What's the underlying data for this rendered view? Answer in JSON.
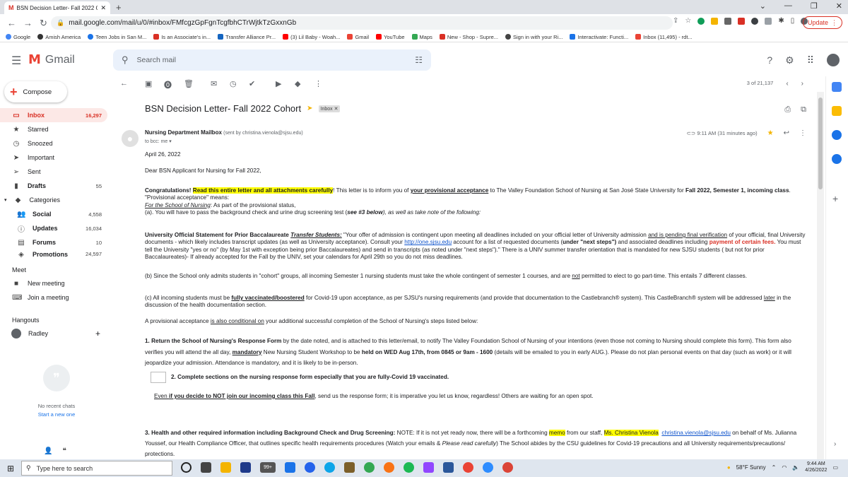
{
  "browser": {
    "tab_title": "BSN Decision Letter- Fall 2022 C",
    "url": "mail.google.com/mail/u/0/#inbox/FMfcgzGpFgnTcgfbhCTrWjtkTzGxxnGb",
    "update_label": "Update"
  },
  "bookmarks": [
    "Google",
    "Amish America",
    "Teen Jobs in San M...",
    "Is an Associate's in...",
    "Transfer Alliance Pr...",
    "(3) Lil Baby - Woah...",
    "Gmail",
    "YouTube",
    "Maps",
    "New - Shop - Supre...",
    "Sign in with your Ri...",
    "Interactivate: Functi...",
    "Inbox (11,495) - rdt..."
  ],
  "gmail": {
    "logo_text": "Gmail",
    "search_placeholder": "Search mail",
    "compose_label": "Compose",
    "nav": [
      {
        "label": "Inbox",
        "count": "16,297"
      },
      {
        "label": "Starred",
        "count": ""
      },
      {
        "label": "Snoozed",
        "count": ""
      },
      {
        "label": "Important",
        "count": ""
      },
      {
        "label": "Sent",
        "count": ""
      },
      {
        "label": "Drafts",
        "count": "55"
      },
      {
        "label": "Categories",
        "count": ""
      },
      {
        "label": "Social",
        "count": "4,558"
      },
      {
        "label": "Updates",
        "count": "16,034"
      },
      {
        "label": "Forums",
        "count": "10"
      },
      {
        "label": "Promotions",
        "count": "24,597"
      }
    ],
    "meet": {
      "heading": "Meet",
      "new_meeting": "New meeting",
      "join_meeting": "Join a meeting"
    },
    "hangouts": {
      "heading": "Hangouts",
      "user": "Radley",
      "no_chats": "No recent chats",
      "start_new": "Start a new one"
    },
    "paging": "3 of 21,137"
  },
  "email": {
    "subject": "BSN Decision Letter- Fall 2022 Cohort",
    "label": "Inbox",
    "sender_name": "Nursing Department Mailbox",
    "sender_via": "(sent by christina.vienola@sjsu.edu)",
    "to": "to bcc: me",
    "time": "9:11 AM (31 minutes ago)",
    "date": "April 26, 2022",
    "greeting": "Dear BSN Applicant for Nursing for Fall 2022,",
    "p1_a": "Congratulations! ",
    "p1_hl": "Read this entire letter and all attachments carefully",
    "p1_b": "! This letter is to inform you of ",
    "p1_u": "your provisional acceptance",
    "p1_c": " to The Valley Foundation School of Nursing at San José State University for ",
    "p1_d": "Fall 2022, Semester 1, incoming class",
    "p1_e": ". \"Provisional acceptance\" means:",
    "p1_f": "For the School of Nursing",
    "p1_g": ": As part of the provisional status,",
    "p1_h": "(a). You will have to pass the background check and urine drug screening test (",
    "p1_i": "see #3 below",
    "p1_j": "), as well as take note of the following:",
    "p2_a": "University Official Statement for Prior Baccalaureate ",
    "p2_b": "Transfer Students:",
    "p2_c": " \"Your offer of admission is contingent upon meeting all deadlines included on your official letter of University admission ",
    "p2_d": "and is pending final verification",
    "p2_e": " of your official, final University documents - which likely includes transcript updates (as well as University acceptance). Consult your ",
    "p2_link": "http://one.sjsu.edu",
    "p2_f": "  account for a list of requested documents (",
    "p2_g": "under \"next steps\")",
    "p2_h": " and associated deadlines including ",
    "p2_i": "payment of certain fees.",
    "p2_j": " You must tell the University \"yes or no\" (by May 1st with exception being prior Baccalaureates) and send in transcripts (as noted under \"next steps\").\" There is a UNIV summer transfer orientation that is mandated for new SJSU students ( but not for prior Baccalaureates)- If already accepted for the Fall by the UNIV, set your calendars for April 29th so you do not miss deadlines.",
    "p3_a": "(b) Since the School only admits students in \"cohort\" groups, all incoming Semester 1 nursing students must take the whole contingent of semester 1 courses, and are ",
    "p3_u": "not",
    "p3_b": " permitted to elect to go part-time. This entails 7 different classes.",
    "p4_a": "(c) All incoming students must be ",
    "p4_u": "fully vaccinated/boostered",
    "p4_b": " for Covid-19 upon acceptance, as per SJSU's nursing requirements (and provide that documentation to the Castlebranch® system). This CastleBranch® system will be addressed ",
    "p4_u2": "later",
    "p4_c": " in the discussion of the health documentation section.",
    "p5_a": "A provisional acceptance ",
    "p5_u": "is also conditional on",
    "p5_b": " your additional successful completion of the School of Nursing's steps listed below:",
    "p6_a": "1.  Return the School of Nursing's Response Form",
    "p6_b": " by the date noted, and is attached to this letter/email, to notify The Valley Foundation School of Nursing of your intentions (even those not coming to Nursing should complete this form). This form also verifies you will attend the all day, ",
    "p6_u": "mandatory",
    "p6_c": " New Nursing Student Workshop to be ",
    "p6_d": "held on WED Aug 17th, from 0845 or 9am - 1600",
    "p6_e": " (details will be emailed to you in early AUG.).  Please do not plan personal events on that day (such as work) or it will jeopardize your admission. Attendance is mandatory, and it is likely to be in-person.",
    "p7": "2.  Complete sections on the nursing response form especially that you are fully-Covid 19 vaccinated.",
    "p8_a": "Even ",
    "p8_b": "if you decide to NOT join our incoming class this Fall",
    "p8_c": ", send us the response form; it is imperative you let us know, regardless! Others are waiting for an open spot.",
    "p9_a": "3.  Health and other required information including Background Check and Drug Screening:",
    "p9_b": "  NOTE: If it is not yet ready now, there will be a forthcoming ",
    "p9_hl1": "memo",
    "p9_c": " from our staff, ",
    "p9_hl2": "Ms. Christina Vienola",
    "p9_link": "christina.vienola@sjsu.edu",
    "p9_d": "  on behalf of Ms. Julianna Youssef, our Health Compliance Officer, that outlines specific health requirements procedures (Watch your emails & ",
    "p9_i": "Please read carefully",
    "p9_e": ") The School abides by the CSU guidelines for Covid-19 precautions and all University requirements/precautions/ protections."
  },
  "taskbar": {
    "search_placeholder": "Type here to search",
    "badge": "99+",
    "weather": "58°F  Sunny",
    "time": "9:44 AM",
    "date": "4/26/2022"
  }
}
